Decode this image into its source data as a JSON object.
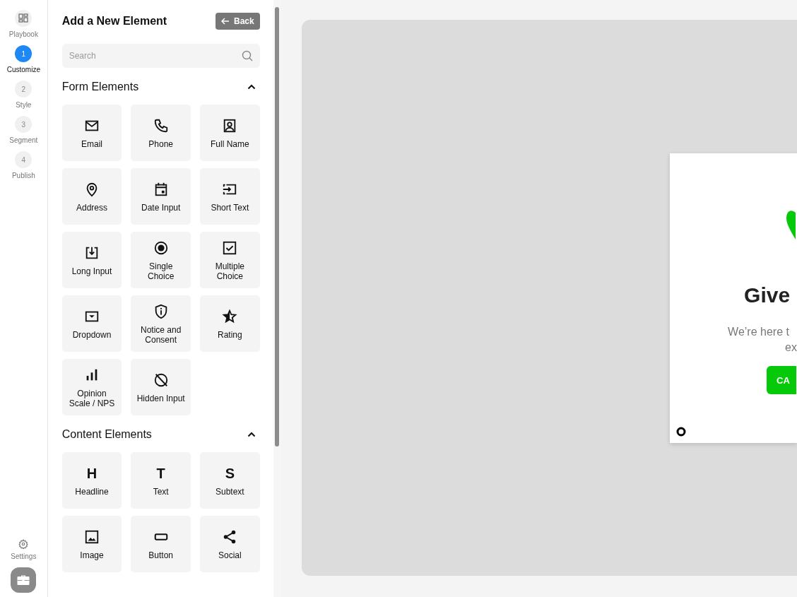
{
  "rail": {
    "items": [
      {
        "kind": "icon",
        "label": "Playbook",
        "selected": false
      },
      {
        "kind": "step",
        "number": "1",
        "label": "Customize",
        "selected": true
      },
      {
        "kind": "step",
        "number": "2",
        "label": "Style",
        "selected": false
      },
      {
        "kind": "step",
        "number": "3",
        "label": "Segment",
        "selected": false
      },
      {
        "kind": "step",
        "number": "4",
        "label": "Publish",
        "selected": false
      }
    ],
    "settings": {
      "label": "Settings"
    }
  },
  "panel": {
    "title": "Add a New Element",
    "back_button": "Back",
    "search": {
      "placeholder": "Search"
    },
    "sections": [
      {
        "title": "Form Elements",
        "expanded": true,
        "items": [
          {
            "kind": "email",
            "label": "Email"
          },
          {
            "kind": "phone",
            "label": "Phone"
          },
          {
            "kind": "contact",
            "label": "Full Name"
          },
          {
            "kind": "location",
            "label": "Address"
          },
          {
            "kind": "calendar",
            "label": "Date Input"
          },
          {
            "kind": "input",
            "label": "Short Text"
          },
          {
            "kind": "download",
            "label": "Long Input"
          },
          {
            "kind": "radio",
            "label": "Single Choice"
          },
          {
            "kind": "checkbox",
            "label": "Multiple Choice"
          },
          {
            "kind": "dropdown",
            "label": "Dropdown"
          },
          {
            "kind": "shield",
            "label": "Notice and Consent"
          },
          {
            "kind": "star",
            "label": "Rating"
          },
          {
            "kind": "bars",
            "label": "Opinion Scale / NPS"
          },
          {
            "kind": "hidden",
            "label": "Hidden Input"
          }
        ]
      },
      {
        "title": "Content Elements",
        "expanded": true,
        "items": [
          {
            "kind": "letter",
            "glyph": "H",
            "label": "Headline"
          },
          {
            "kind": "letter",
            "glyph": "T",
            "label": "Text"
          },
          {
            "kind": "letter",
            "glyph": "S",
            "label": "Subtext"
          },
          {
            "kind": "image",
            "label": "Image"
          },
          {
            "kind": "button",
            "label": "Button"
          },
          {
            "kind": "share",
            "label": "Social"
          }
        ]
      }
    ]
  },
  "preview": {
    "headline": "Give",
    "body_lines": [
      "We’re here t",
      "ex"
    ],
    "cta": "CA"
  }
}
